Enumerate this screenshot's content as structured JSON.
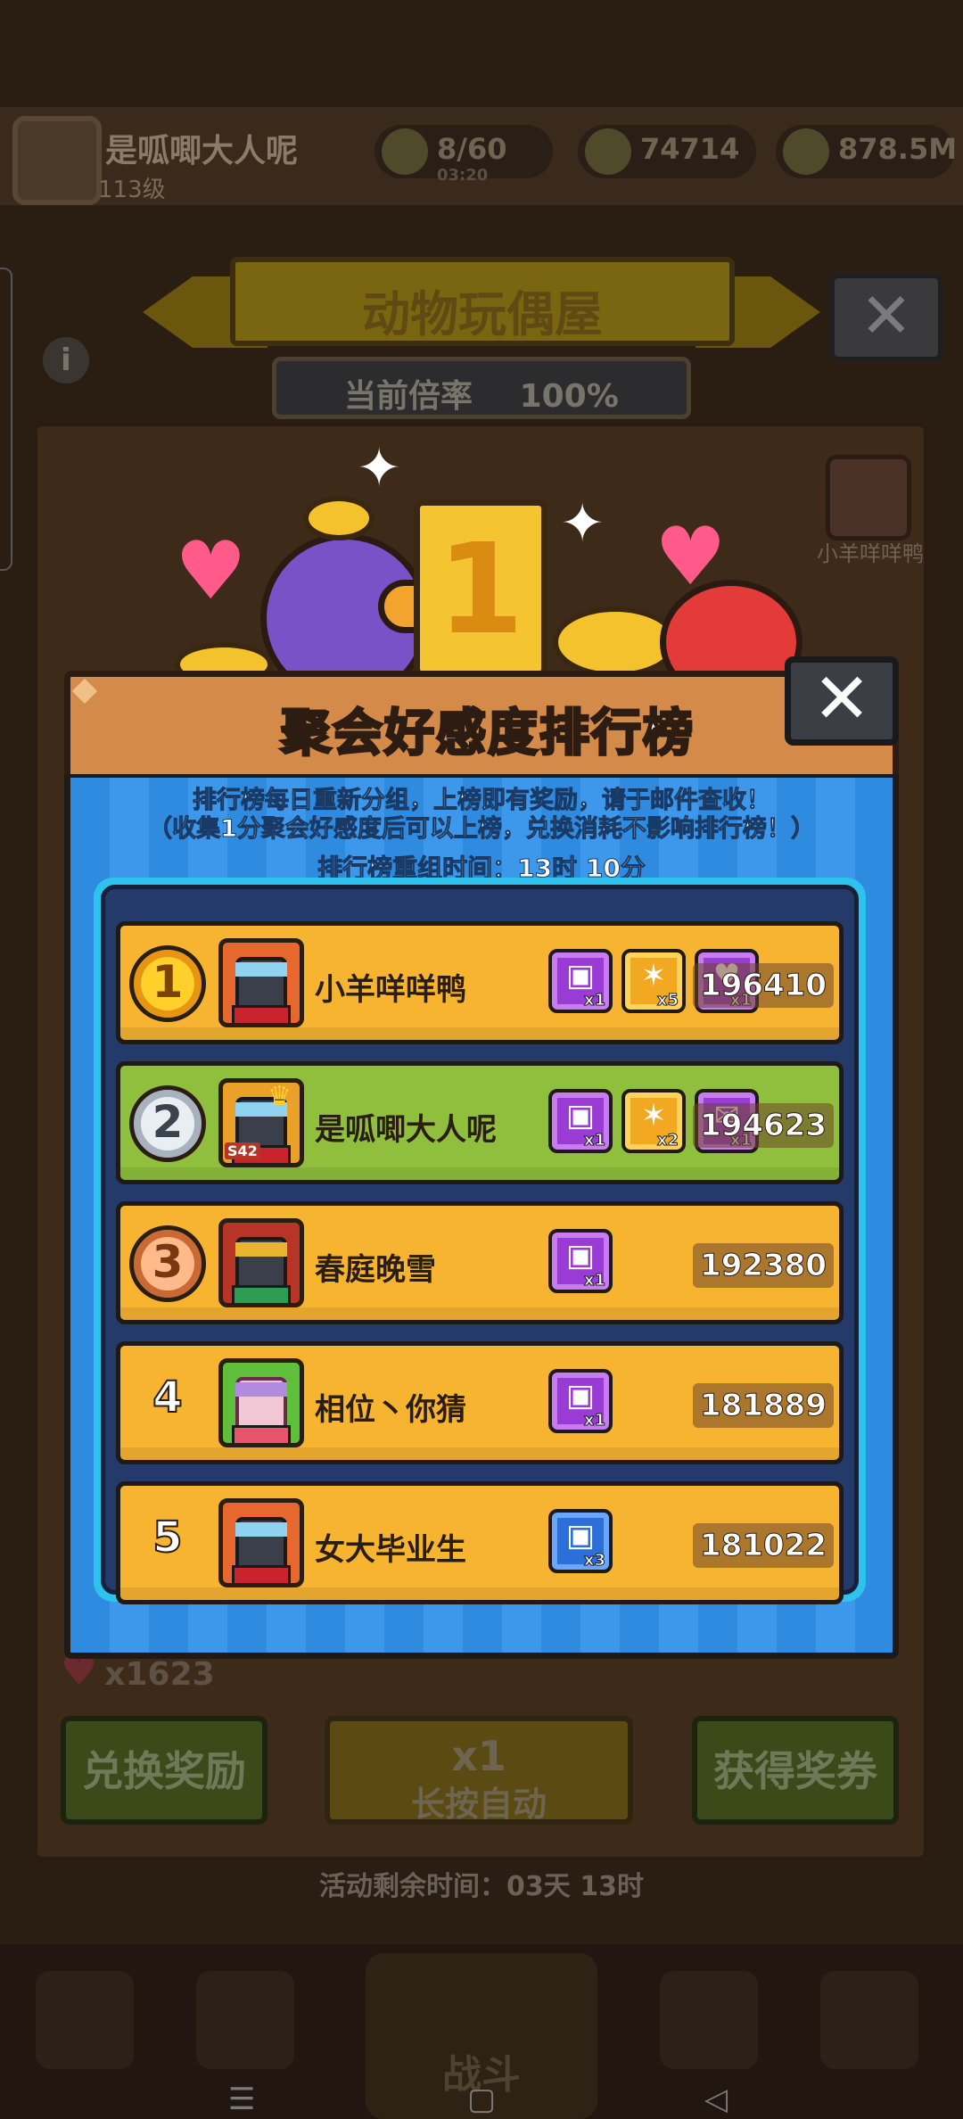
{
  "background": {
    "player_name": "是呱唧大人呢",
    "player_level": "113级",
    "stamina": "8/60",
    "stamina_timer": "03:20",
    "currency_1": "74714",
    "currency_2": "878.5M",
    "event_title": "动物玩偶屋",
    "rate_label": "当前倍率",
    "rate_value": "100%",
    "side_item_label": "小羊咩咩鸭",
    "heart_count": "x1623",
    "multiplier_badge": "x1",
    "exchange_button": "兑换奖励",
    "spin_multiplier": "x1",
    "spin_label": "长按自动",
    "get_ticket_button": "获得奖券",
    "time_remaining": "活动剩余时间：03天 13时",
    "battle_label": "战斗"
  },
  "modal": {
    "title": "聚会好感度排行榜",
    "close_symbol": "✕",
    "notice_line1": "排行榜每日重新分组，上榜即有奖励，请于邮件查收！",
    "notice_line2": "（收集1分聚会好感度后可以上榜，兑换消耗不影响排行榜！）",
    "reset_time": "排行榜重组时间：13时 10分"
  },
  "leaderboard": [
    {
      "rank": "1",
      "name": "小羊咩咩鸭",
      "score": "196410",
      "rewards": [
        {
          "type": "purple-chest-icon",
          "qty": "x1"
        },
        {
          "type": "gold-ticket-icon",
          "qty": "x5"
        },
        {
          "type": "heart-chest-icon",
          "qty": "x1"
        }
      ]
    },
    {
      "rank": "2",
      "name": "是呱唧大人呢",
      "score": "194623",
      "avatar_tag": "S42",
      "rewards": [
        {
          "type": "purple-chest-icon",
          "qty": "x1"
        },
        {
          "type": "gold-ticket-icon",
          "qty": "x2"
        },
        {
          "type": "gift-box-icon",
          "qty": "x1"
        }
      ]
    },
    {
      "rank": "3",
      "name": "春庭晚雪",
      "score": "192380",
      "rewards": [
        {
          "type": "purple-chest-icon",
          "qty": "x1"
        }
      ]
    },
    {
      "rank": "4",
      "name": "相位丶你猜",
      "score": "181889",
      "rewards": [
        {
          "type": "purple-chest-icon",
          "qty": "x1"
        }
      ]
    },
    {
      "rank": "5",
      "name": "女大毕业生",
      "score": "181022",
      "rewards": [
        {
          "type": "blue-chest-icon",
          "qty": "x3"
        }
      ]
    }
  ],
  "colors": {
    "row_default": "#f7b431",
    "row_self": "#8fbf3c",
    "header": "#d48b4a",
    "body_stripe": "#2f8be0",
    "frame": "#2ec3ee"
  }
}
